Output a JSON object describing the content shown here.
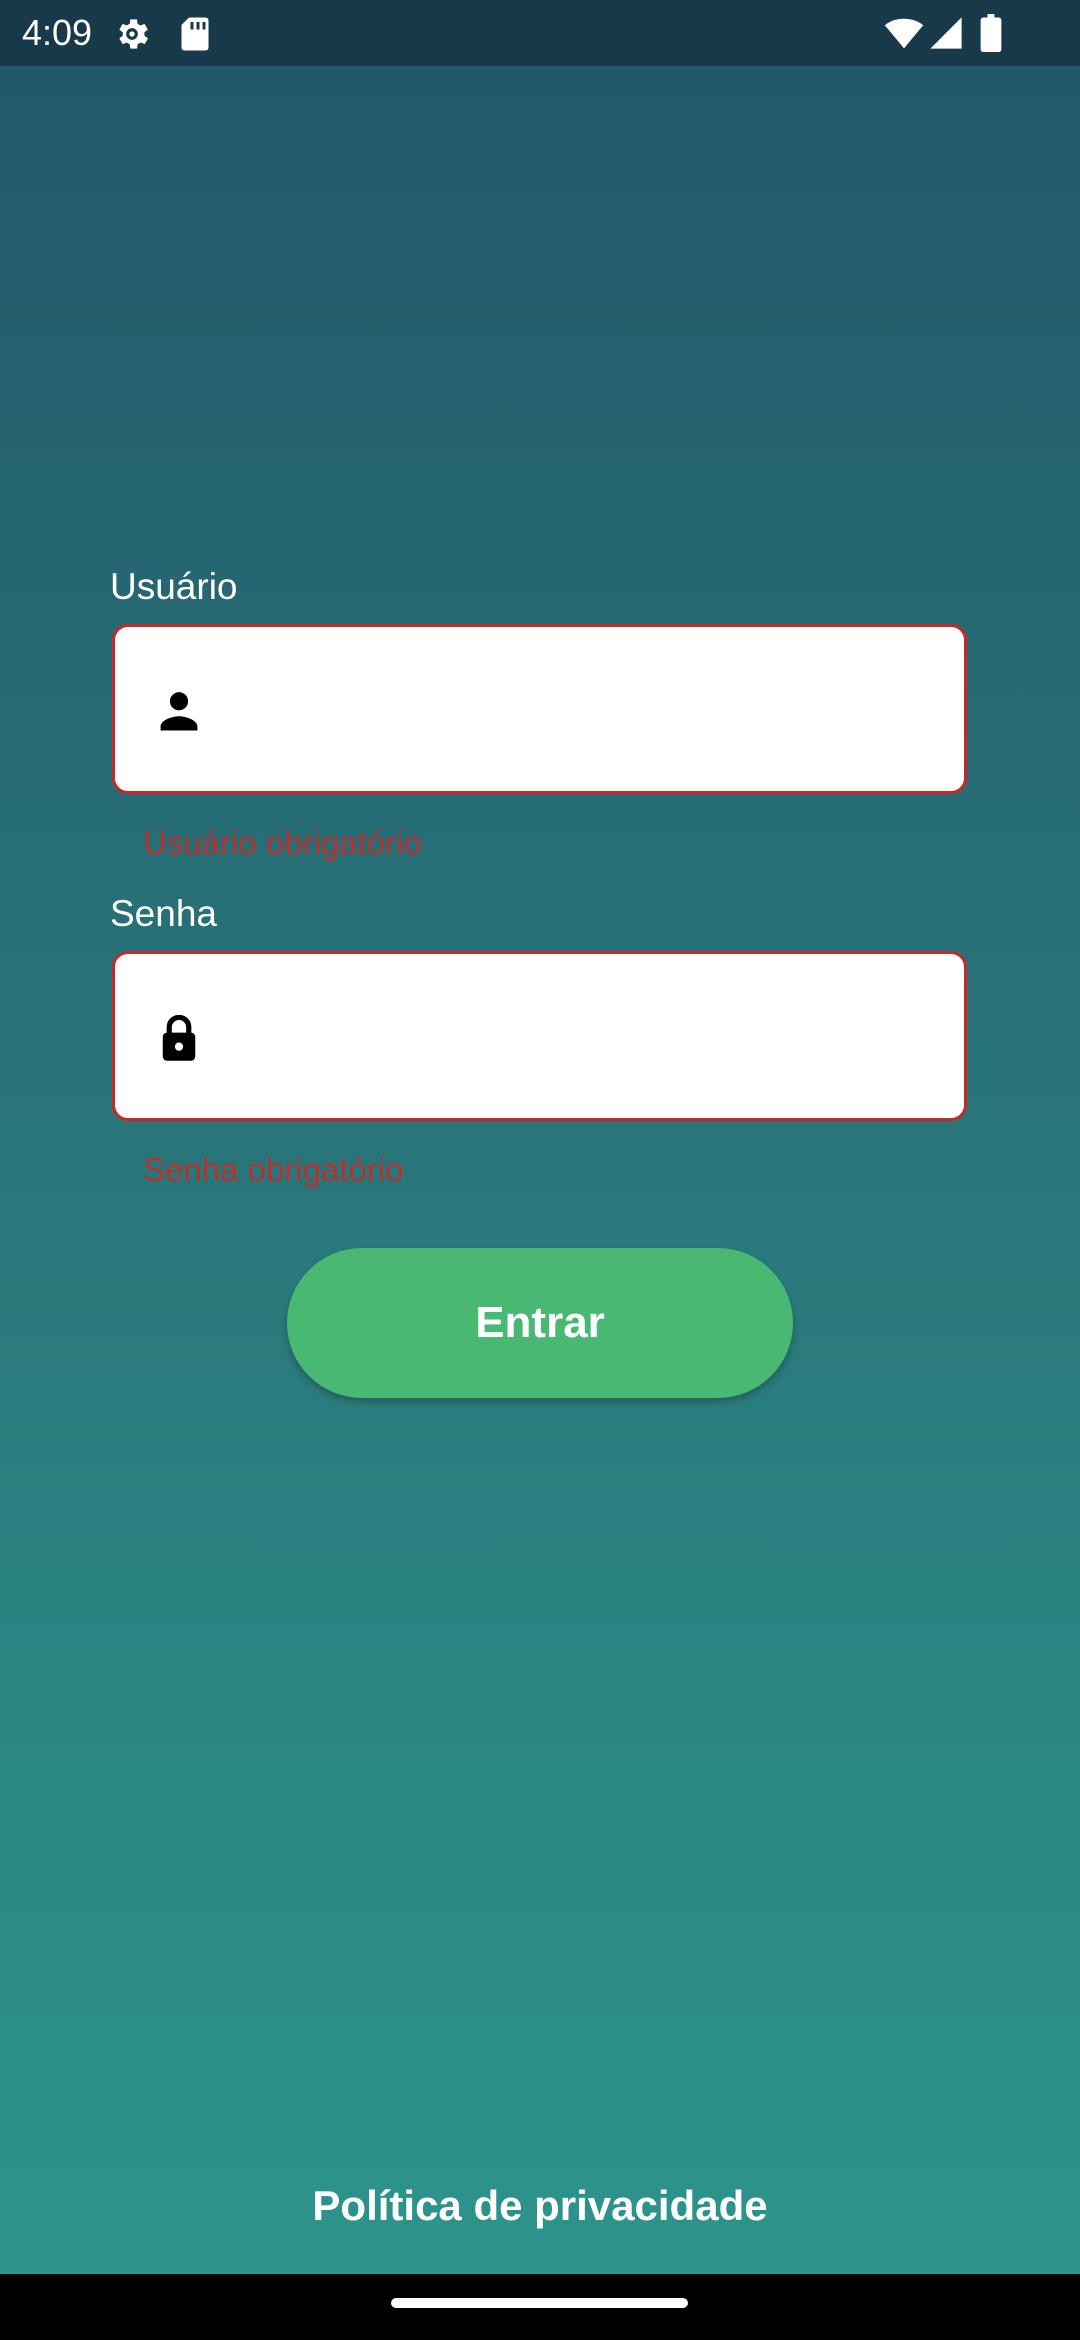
{
  "status_bar": {
    "time": "4:09",
    "icons": [
      "gear-icon",
      "sd-card-icon",
      "wifi-icon",
      "signal-icon",
      "battery-icon"
    ]
  },
  "form": {
    "username": {
      "label": "Usuário",
      "value": "",
      "icon": "person-icon",
      "error": "Usuário obrigatório"
    },
    "password": {
      "label": "Senha",
      "value": "",
      "icon": "lock-icon",
      "error": "Senha obrigatório"
    },
    "submit_label": "Entrar"
  },
  "footer": {
    "privacy_link": "Política de privacidade"
  },
  "colors": {
    "background_top": "#22566a",
    "background_bottom": "#2c968d",
    "status_bar": "#17394a",
    "error": "#c62828",
    "button": "#48b873"
  }
}
